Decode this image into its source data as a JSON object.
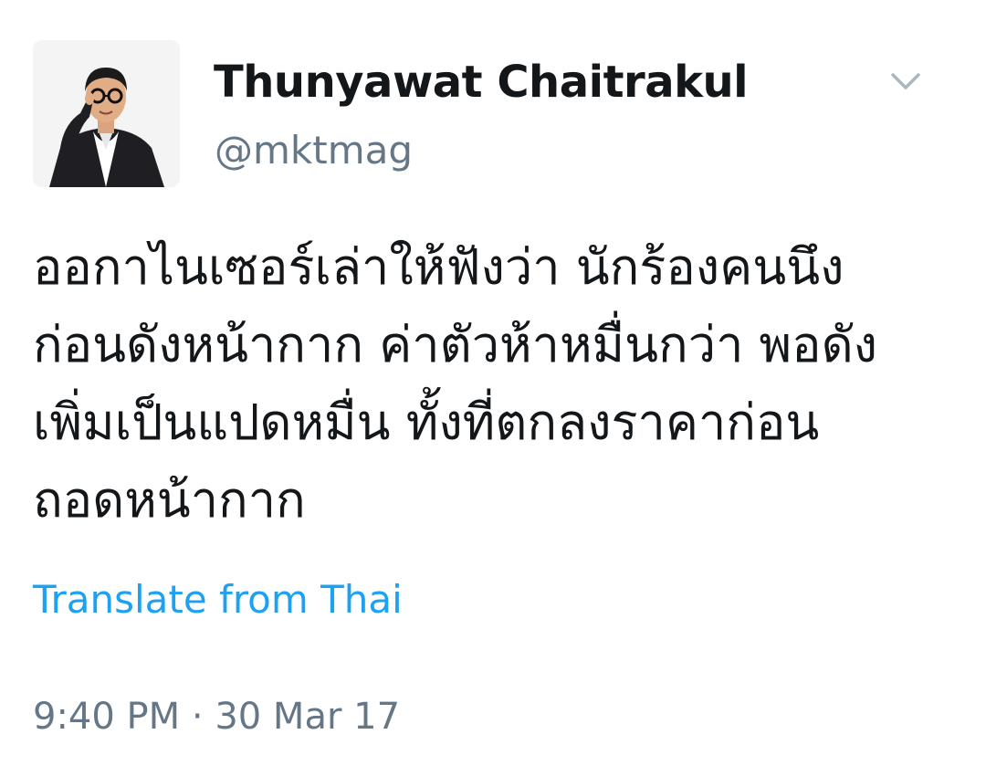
{
  "tweet": {
    "author": {
      "display_name": "Thunyawat Chaitrakul",
      "handle": "@mktmag"
    },
    "text_lines": [
      "ออกาไนเซอร์เล่าให้ฟังว่า นักร้องคนนึง",
      "ก่อนดังหน้ากาก ค่าตัวห้าหมื่นกว่า พอดัง",
      "เพิ่มเป็นแปดหมื่น ทั้งที่ตกลงราคาก่อน",
      "ถอดหน้ากาก"
    ],
    "translate_label": "Translate from Thai",
    "timestamp": "9:40 PM · 30 Mar 17",
    "menu_icon": "chevron-down-icon"
  },
  "colors": {
    "text_primary": "#14171a",
    "text_secondary": "#657786",
    "link": "#1da1f2",
    "chevron": "#aab8c2",
    "background": "#ffffff"
  }
}
